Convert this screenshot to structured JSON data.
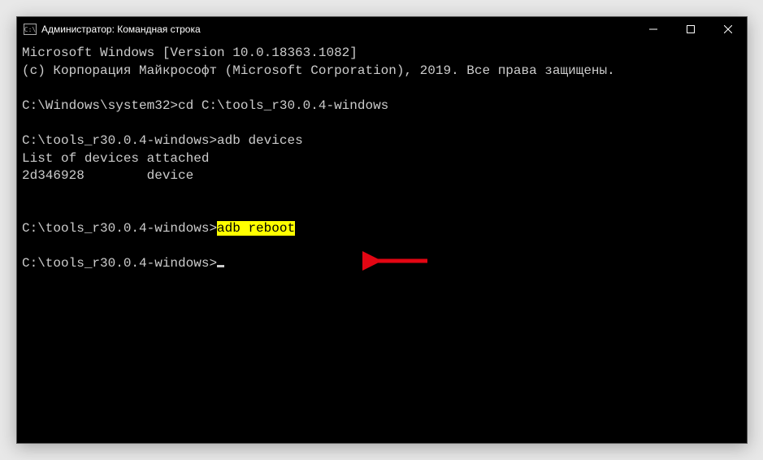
{
  "titlebar": {
    "icon_text": "C:\\",
    "title": "Администратор: Командная строка"
  },
  "terminal": {
    "line1": "Microsoft Windows [Version 10.0.18363.1082]",
    "line2": "(c) Корпорация Майкрософт (Microsoft Corporation), 2019. Все права защищены.",
    "prompt1": "C:\\Windows\\system32>",
    "cmd1": "cd C:\\tools_r30.0.4-windows",
    "prompt2": "C:\\tools_r30.0.4-windows>",
    "cmd2": "adb devices",
    "out1": "List of devices attached",
    "out2": "2d346928        device",
    "prompt3": "C:\\tools_r30.0.4-windows>",
    "cmd3": "adb reboot",
    "prompt4": "C:\\tools_r30.0.4-windows>"
  },
  "annotation": {
    "arrow_color": "#e30613"
  }
}
